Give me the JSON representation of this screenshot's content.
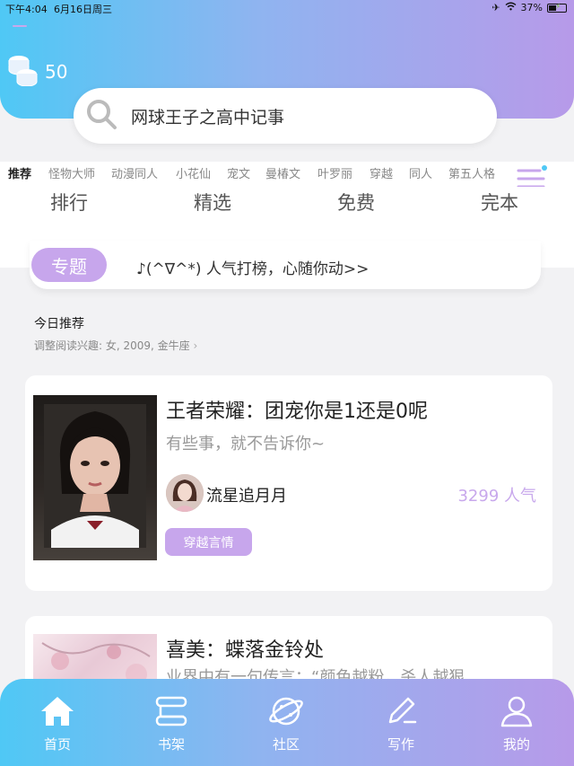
{
  "status_bar": {
    "time": "下午4:04",
    "date": "6月16日周三",
    "battery": "37%"
  },
  "header": {
    "coins": "50"
  },
  "search": {
    "text": "网球王子之高中记事"
  },
  "categories": {
    "items": [
      {
        "label": "推荐"
      },
      {
        "label": "怪物大师"
      },
      {
        "label": "动漫同人"
      },
      {
        "label": "小花仙"
      },
      {
        "label": "宠文"
      },
      {
        "label": "曼椿文"
      },
      {
        "label": "叶罗丽"
      },
      {
        "label": "穿越"
      },
      {
        "label": "同人"
      },
      {
        "label": "第五人格"
      }
    ]
  },
  "subtabs": [
    {
      "label": "排行"
    },
    {
      "label": "精选"
    },
    {
      "label": "免费"
    },
    {
      "label": "完本"
    }
  ],
  "topic": {
    "pill": "专题",
    "text": "♪(^∇^*) 人气打榜，心随你动>>"
  },
  "recommend": {
    "title": "今日推荐",
    "subtitle": "调整阅读兴趣: 女, 2009, 金牛座"
  },
  "books": [
    {
      "title": "王者荣耀：团宠你是1还是0呢",
      "desc": "有些事，就不告诉你~",
      "author": "流星追月月",
      "popularity": "3299 人气",
      "tag": "穿越言情"
    },
    {
      "title": "喜美：蝶落金铃处",
      "desc": "业界中有一句传言：“颜色越粉，杀人越狠"
    }
  ],
  "bottom_nav": [
    {
      "label": "首页",
      "icon": "home-icon"
    },
    {
      "label": "书架",
      "icon": "bookshelf-icon"
    },
    {
      "label": "社区",
      "icon": "community-icon"
    },
    {
      "label": "写作",
      "icon": "write-icon"
    },
    {
      "label": "我的",
      "icon": "profile-icon"
    }
  ],
  "colors": {
    "accent": "#c7a6ec",
    "gradient_start": "#4fc8f5",
    "gradient_end": "#b79ae9"
  }
}
